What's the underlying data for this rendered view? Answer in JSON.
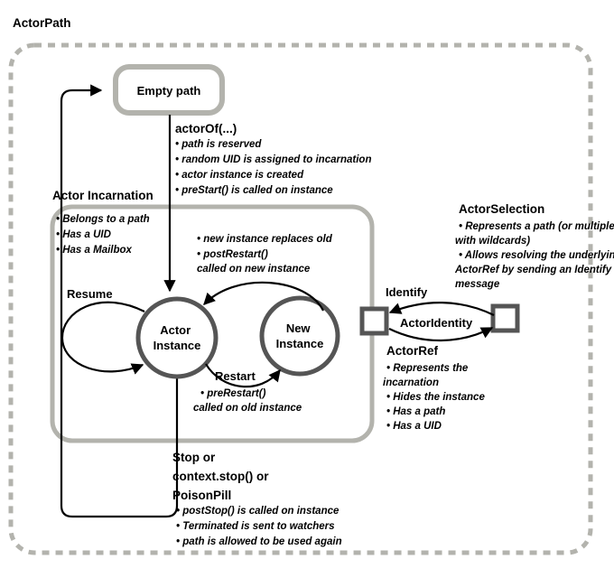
{
  "diagram": {
    "title": "ActorPath",
    "outer_container_label": "ActorPath",
    "nodes": {
      "empty_path": "Empty path",
      "actor_instance_line1": "Actor",
      "actor_instance_line2": "Instance",
      "new_instance_line1": "New",
      "new_instance_line2": "Instance"
    },
    "groups": {
      "incarnation": {
        "title": "Actor Incarnation",
        "bullets": [
          "Belongs to a path",
          "Has a UID",
          "Has a Mailbox"
        ]
      }
    },
    "transitions": {
      "actor_of": {
        "label": "actorOf(...)",
        "bullets": [
          "path is reserved",
          "random UID is assigned to incarnation",
          "actor instance is created",
          "preStart() is called on instance"
        ]
      },
      "restart_out": {
        "bullets": [
          "new instance replaces old",
          "postRestart()"
        ],
        "continuation": "called on new instance"
      },
      "restart": {
        "label": "Restart",
        "bullets": [
          "preRestart()"
        ],
        "continuation": "called on old instance"
      },
      "resume": {
        "label": "Resume"
      },
      "stop": {
        "label_line1": "Stop or",
        "label_line2": "context.stop() or",
        "label_line3": "PoisonPill",
        "bullets": [
          "postStop() is called on instance",
          "Terminated is sent to watchers",
          "path is allowed to be used again"
        ]
      },
      "identify": {
        "label": "Identify"
      },
      "actor_identity": {
        "label": "ActorIdentity"
      }
    },
    "annotations": {
      "actor_selection": {
        "title": "ActorSelection",
        "bullets": [
          "Represents a path (or multiple",
          "with wildcards)",
          "Allows resolving the underlying",
          "ActorRef by sending an Identify",
          "message"
        ],
        "line1": "Represents a path (or multiple",
        "line2": "with wildcards)",
        "line3": "Allows resolving the underlying",
        "line4": "ActorRef by sending an Identify",
        "line5": "message"
      },
      "actor_ref": {
        "title": "ActorRef",
        "line1": "Represents the",
        "line2": "incarnation",
        "line3": "Hides the instance",
        "line4": "Has a path",
        "line5": "Has a UID"
      }
    },
    "colors": {
      "gray_border": "#b3b3ad",
      "node_stroke": "#555555",
      "edge": "#000000",
      "background": "#ffffff"
    }
  }
}
